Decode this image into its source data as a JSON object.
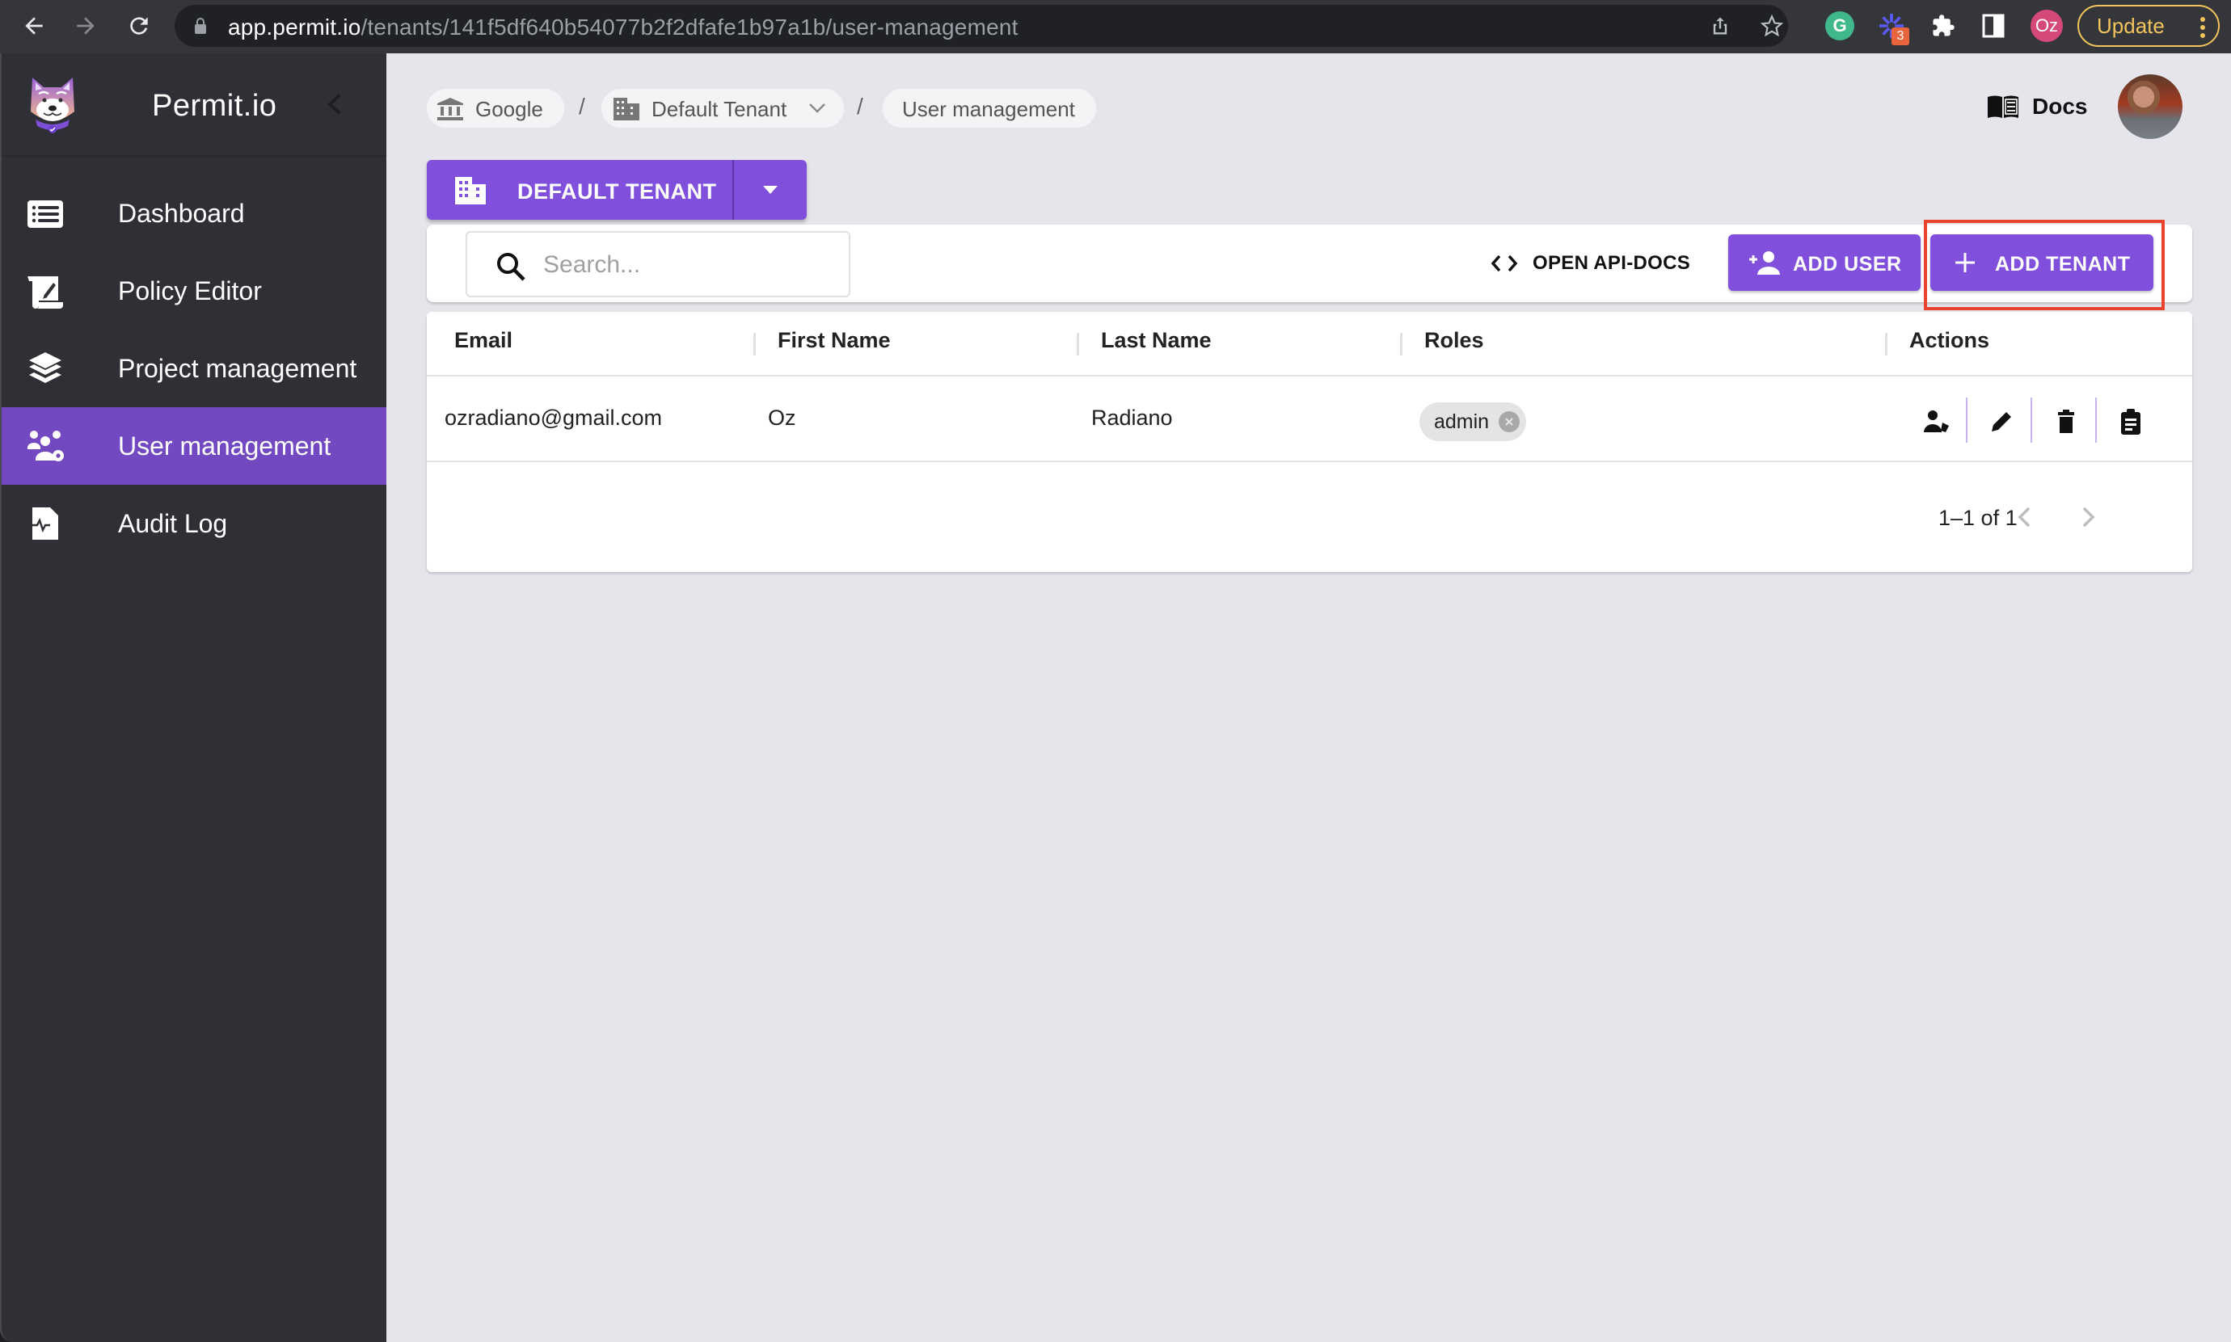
{
  "browser": {
    "url_host": "app.permit.io",
    "url_path": "/tenants/141f5df640b54077b2f2dfafe1b97a1b/user-management",
    "extension_badge": "3",
    "profile_initials": "Oz",
    "update_label": "Update"
  },
  "sidebar": {
    "brand": "Permit.io",
    "items": [
      {
        "label": "Dashboard",
        "icon": "list-icon",
        "active": false
      },
      {
        "label": "Policy Editor",
        "icon": "scroll-pen-icon",
        "active": false
      },
      {
        "label": "Project management",
        "icon": "layers-icon",
        "active": false
      },
      {
        "label": "User management",
        "icon": "users-gear-icon",
        "active": true
      },
      {
        "label": "Audit Log",
        "icon": "file-pulse-icon",
        "active": false
      }
    ]
  },
  "breadcrumb": {
    "items": [
      {
        "label": "Google",
        "icon": "bank-icon"
      },
      {
        "label": "Default Tenant",
        "icon": "building-icon",
        "dropdown": true
      },
      {
        "label": "User management"
      }
    ],
    "separator": "/"
  },
  "header": {
    "docs_label": "Docs"
  },
  "tenant_selector": {
    "label": "DEFAULT TENANT"
  },
  "toolbar": {
    "search_placeholder": "Search...",
    "search_value": "",
    "api_docs_label": "OPEN API-DOCS",
    "add_user_label": "ADD USER",
    "add_tenant_label": "ADD TENANT"
  },
  "table": {
    "columns": [
      "Email",
      "First Name",
      "Last Name",
      "Roles",
      "Actions"
    ],
    "rows": [
      {
        "email": "ozradiano@gmail.com",
        "first_name": "Oz",
        "last_name": "Radiano",
        "roles": [
          "admin"
        ]
      }
    ],
    "pagination": "1–1 of 1"
  },
  "colors": {
    "accent": "#8050dd",
    "sidebar_active": "#7349c2",
    "sidebar_bg": "#2f3036",
    "main_bg": "#e6e5ec",
    "highlight": "#e8442d"
  }
}
